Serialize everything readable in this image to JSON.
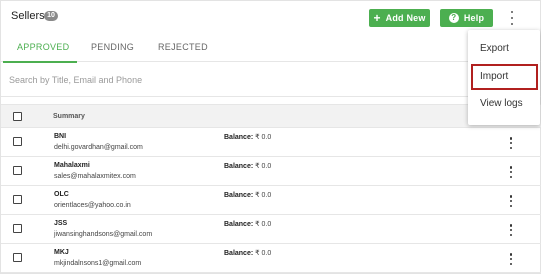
{
  "header": {
    "title": "Sellers",
    "count": "10",
    "add_new_label": "Add New",
    "add_new_glyph": "+",
    "help_label": "Help",
    "help_glyph": "?"
  },
  "tabs": [
    {
      "label": "APPROVED",
      "active": true
    },
    {
      "label": "PENDING",
      "active": false
    },
    {
      "label": "REJECTED",
      "active": false
    }
  ],
  "search": {
    "placeholder": "Search by Title, Email and Phone",
    "value": ""
  },
  "table": {
    "column_summary": "Summary",
    "rows": [
      {
        "name": "BNI",
        "email": "delhi.govardhan@gmail.com",
        "balance_label": "Balance:",
        "balance_value": "₹ 0.0"
      },
      {
        "name": "Mahalaxmi",
        "email": "sales@mahalaxmitex.com",
        "balance_label": "Balance:",
        "balance_value": "₹ 0.0"
      },
      {
        "name": "OLC",
        "email": "orientlaces@yahoo.co.in",
        "balance_label": "Balance:",
        "balance_value": "₹ 0.0"
      },
      {
        "name": "JSS",
        "email": "jiwansinghandsons@gmail.com",
        "balance_label": "Balance:",
        "balance_value": "₹ 0.0"
      },
      {
        "name": "MKJ",
        "email": "mkjindalnsons1@gmail.com",
        "balance_label": "Balance:",
        "balance_value": "₹ 0.0"
      }
    ]
  },
  "menu": {
    "items": [
      {
        "label": "Export"
      },
      {
        "label": "Import",
        "highlighted": true
      },
      {
        "label": "View logs"
      }
    ]
  },
  "colors": {
    "accent": "#4caf50",
    "highlight_border": "#b1201f",
    "badge": "#8a8a8a"
  },
  "icons": {
    "add": "plus-icon",
    "help": "question-icon",
    "more": "kebab-icon"
  }
}
